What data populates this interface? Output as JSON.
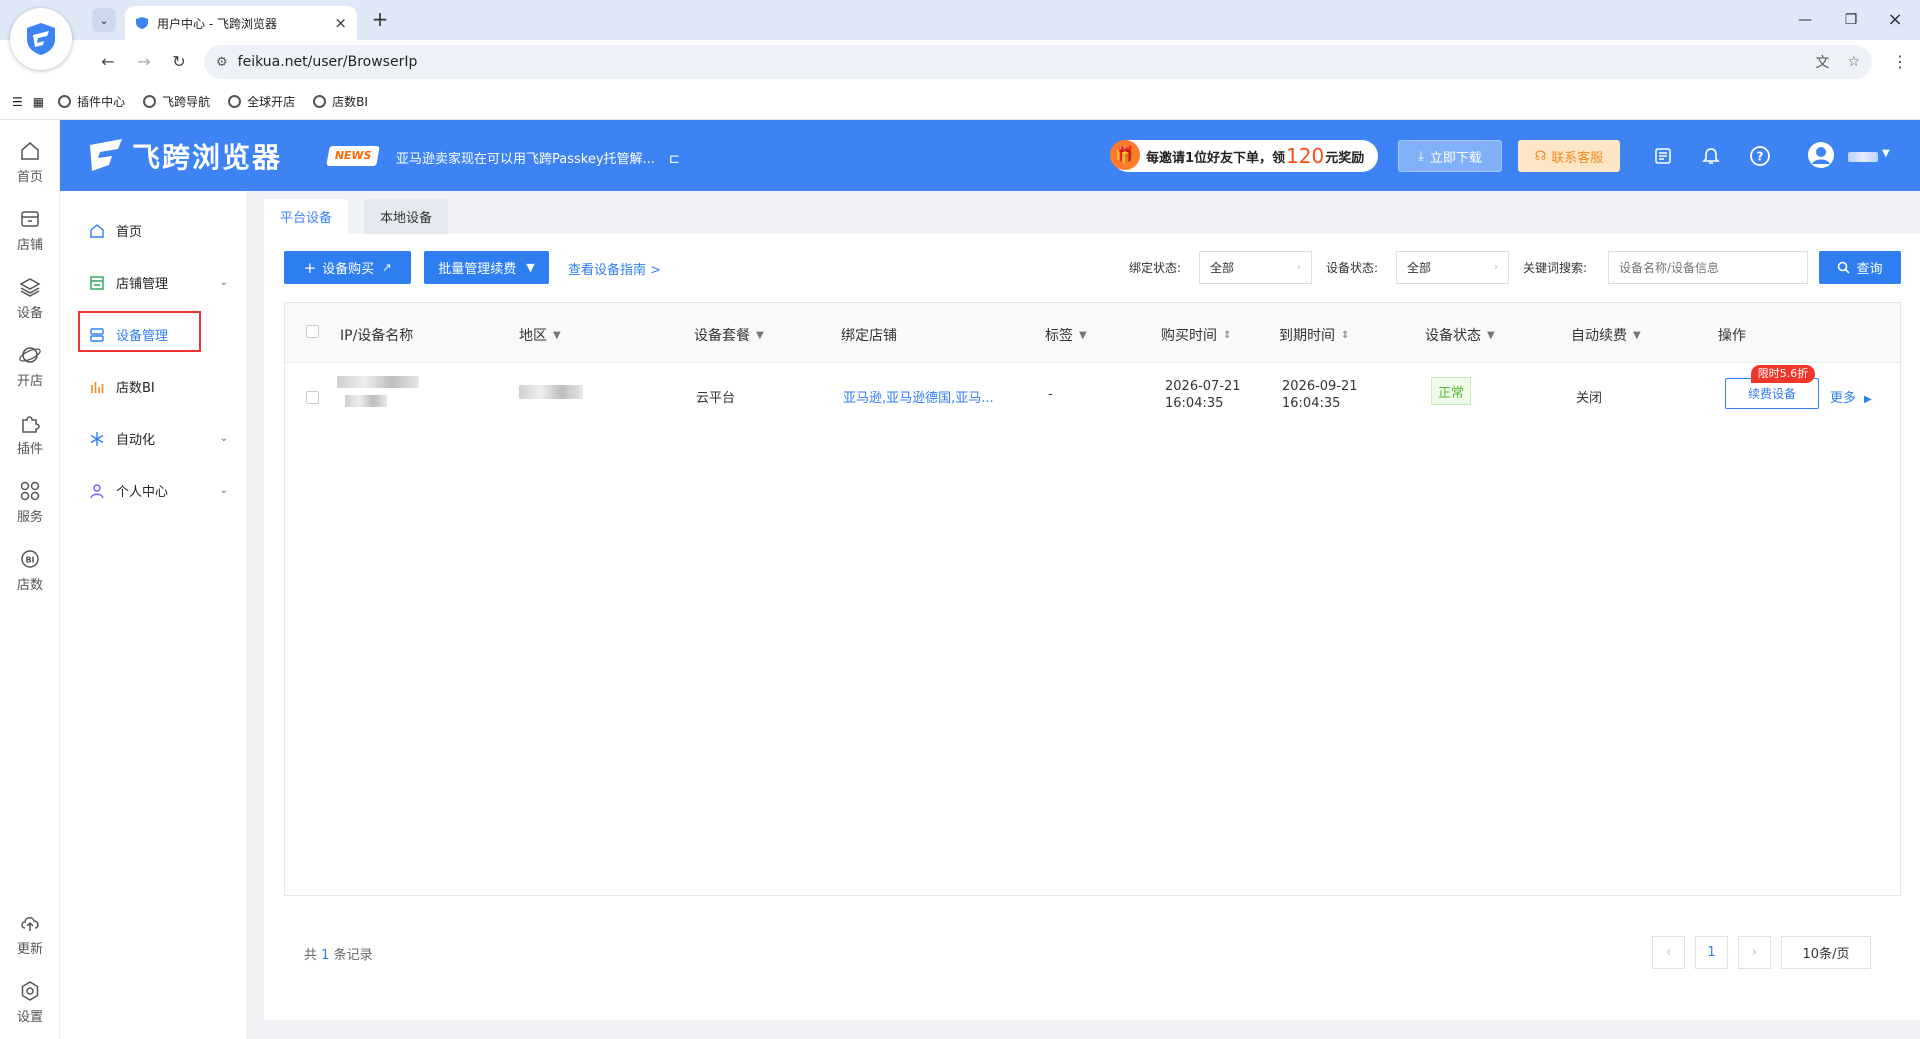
{
  "browser": {
    "tab_title": "用户中心 - 飞跨浏览器",
    "url": "feikua.net/user/BrowserIp",
    "bookmarks": [
      "插件中心",
      "飞跨导航",
      "全球开店",
      "店数BI"
    ]
  },
  "header": {
    "logo_text": "飞跨浏览器",
    "news_badge": "NEWS",
    "news_text": "亚马逊卖家现在可以用飞跨Passkey托管解...",
    "invite_prefix": "每邀请1位好友下单，领",
    "invite_amount": "120",
    "invite_suffix": "元奖励",
    "download_label": "立即下载",
    "support_label": "联系客服"
  },
  "rail": {
    "items": [
      {
        "label": "首页",
        "icon": "home-icon"
      },
      {
        "label": "店铺",
        "icon": "store-icon"
      },
      {
        "label": "设备",
        "icon": "layers-icon"
      },
      {
        "label": "开店",
        "icon": "globe-icon"
      },
      {
        "label": "插件",
        "icon": "puzzle-icon"
      },
      {
        "label": "服务",
        "icon": "grid-icon"
      },
      {
        "label": "店数",
        "icon": "bi-icon"
      }
    ],
    "bottom": [
      {
        "label": "更新",
        "icon": "cloud-upload-icon"
      },
      {
        "label": "设置",
        "icon": "settings-icon"
      }
    ]
  },
  "sidebar": {
    "items": [
      {
        "label": "首页",
        "has_chevron": false
      },
      {
        "label": "店铺管理",
        "has_chevron": true
      },
      {
        "label": "设备管理",
        "has_chevron": false,
        "active": true
      },
      {
        "label": "店数BI",
        "has_chevron": false
      },
      {
        "label": "自动化",
        "has_chevron": true
      },
      {
        "label": "个人中心",
        "has_chevron": true
      }
    ]
  },
  "main": {
    "tabs": [
      "平台设备",
      "本地设备"
    ],
    "buy_label": "设备购买",
    "batch_label": "批量管理续费",
    "guide_label": "查看设备指南 >",
    "filters": {
      "bind_status_label": "绑定状态:",
      "bind_status_value": "全部",
      "device_status_label": "设备状态:",
      "device_status_value": "全部",
      "keyword_label": "关键词搜索:",
      "keyword_placeholder": "设备名称/设备信息"
    },
    "query_label": "查询",
    "table": {
      "headers": [
        "IP/设备名称",
        "地区",
        "设备套餐",
        "绑定店铺",
        "标签",
        "购买时间",
        "到期时间",
        "设备状态",
        "自动续费",
        "操作"
      ],
      "row": {
        "plan": "云平台",
        "shops": "亚马逊,亚马逊德国,亚马...",
        "tag": "-",
        "buy_date": "2026-07-21",
        "buy_time": "16:04:35",
        "expire_date": "2026-09-21",
        "expire_time": "16:04:35",
        "status": "正常",
        "auto_renew": "关闭",
        "discount": "限时5.6折",
        "renew_label": "续费设备",
        "more_label": "更多"
      }
    },
    "footer": {
      "total_prefix": "共",
      "total_count": "1",
      "total_suffix": "条记录",
      "page": "1",
      "page_size": "10条/页"
    }
  },
  "colors": {
    "brand": "#3d83f4",
    "primary": "#2f7ef0",
    "success": "#5cb82e",
    "danger": "#f0382a"
  }
}
